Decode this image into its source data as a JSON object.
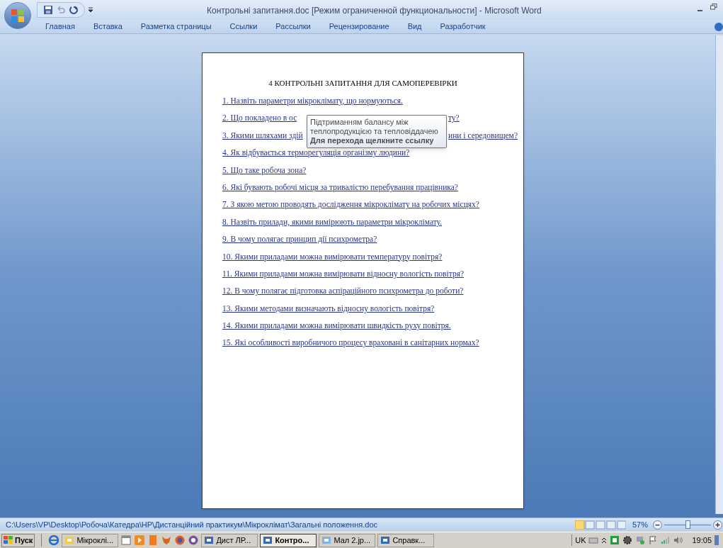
{
  "window": {
    "title": "Контрольні запитання.doc [Режим ограниченной функциональности] - Microsoft Word"
  },
  "ribbon_tabs": [
    {
      "label": "Главная"
    },
    {
      "label": "Вставка"
    },
    {
      "label": "Разметка страницы"
    },
    {
      "label": "Ссылки"
    },
    {
      "label": "Рассылки"
    },
    {
      "label": "Рецензирование"
    },
    {
      "label": "Вид"
    },
    {
      "label": "Разработчик"
    }
  ],
  "document": {
    "heading": "4 КОНТРОЛЬНІ ЗАПИТАННЯ ДЛЯ САМОПЕРЕВІРКИ",
    "questions": [
      {
        "segments": [
          "1. Назвіть параметри мікроклімату, що нормуються."
        ]
      },
      {
        "segments": [
          "2. Що покладено в ос",
          "ту?"
        ]
      },
      {
        "segments": [
          "3. Якими шляхами здій",
          "ини і середовищем?"
        ]
      },
      {
        "segments": [
          "4. Як відбувається терморегуляція організму людини?"
        ]
      },
      {
        "segments": [
          "5. Що таке робоча зона?"
        ]
      },
      {
        "segments": [
          "6. Які бувають робочі місця за тривалістю перебування працівника?"
        ]
      },
      {
        "segments": [
          "7. З якою метою проводять дослідження мікроклімату на робочих місцях?"
        ]
      },
      {
        "segments": [
          "8. Назвіть прилади, якими вимірюють параметри мікроклімату."
        ]
      },
      {
        "segments": [
          "9. В чому полягає принцип дії психрометра?"
        ]
      },
      {
        "segments": [
          "10. Якими приладами можна вимірювати температуру повітря?"
        ]
      },
      {
        "segments": [
          "11. Якими приладами можна вимірювати відносну вологість повітря?"
        ]
      },
      {
        "segments": [
          "12. В чому полягає підготовка аспіраційного психрометра до роботи?"
        ]
      },
      {
        "segments": [
          "13. Якими методами визначають відносну вологість повітря?"
        ]
      },
      {
        "segments": [
          "14. Якими приладами можна вимірювати швидкість руху повітря."
        ]
      },
      {
        "segments": [
          "15. Які особливості виробничого процесу враховані в санітарних нормах?"
        ]
      }
    ]
  },
  "tooltip": {
    "lines": [
      "Підтриманням балансу між",
      "теплопродукцією та тепловіддачею"
    ],
    "hint": "Для перехода щелкните ссылку"
  },
  "status_bar": {
    "path": "C:\\Users\\VP\\Desktop\\Робоча\\Катедра\\НР\\Дистанційний практикум\\Мікроклімат\\Загальні положення.doc",
    "zoom": "57%",
    "zoom_slider": {
      "level": 0.5
    }
  },
  "taskbar": {
    "start": "Пуск",
    "tasks": [
      {
        "label": "Мікроклі...",
        "selected": false
      },
      {
        "label": "Дист ЛР...",
        "selected": false
      },
      {
        "label": "Контро...",
        "selected": true
      },
      {
        "label": "Мал 2.jp...",
        "selected": false
      },
      {
        "label": "Справк...",
        "selected": false
      }
    ],
    "language": "UK",
    "clock": "19:05"
  }
}
